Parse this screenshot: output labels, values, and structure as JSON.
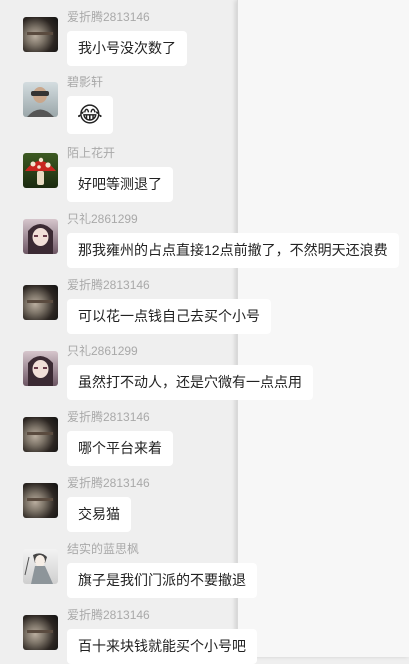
{
  "messages": [
    {
      "avatar": "dark-planet-avatar",
      "sender": "爱折腾2813146",
      "text": "我小号没次数了"
    },
    {
      "avatar": "driver-avatar",
      "sender": "碧影轩",
      "text": "😂"
    },
    {
      "avatar": "mushroom-avatar",
      "sender": "陌上花开",
      "text": "好吧等测退了"
    },
    {
      "avatar": "anime-girl-avatar",
      "sender": "只礼2861299",
      "text": "那我雍州的占点直接12点前撤了，不然明天还浪费"
    },
    {
      "avatar": "dark-planet-avatar",
      "sender": "爱折腾2813146",
      "text": "可以花一点钱自己去买个小号"
    },
    {
      "avatar": "anime-girl-avatar",
      "sender": "只礼2861299",
      "text": "虽然打不动人，还是穴微有一点点用"
    },
    {
      "avatar": "dark-planet-avatar",
      "sender": "爱折腾2813146",
      "text": "哪个平台来着"
    },
    {
      "avatar": "dark-planet-avatar",
      "sender": "爱折腾2813146",
      "text": "交易猫"
    },
    {
      "avatar": "ink-figure-avatar",
      "sender": "结实的蓝思枫",
      "text": "旗子是我们门派的不要撤退"
    },
    {
      "avatar": "dark-planet-avatar",
      "sender": "爱折腾2813146",
      "text": "百十来块钱就能买个小号吧"
    }
  ]
}
